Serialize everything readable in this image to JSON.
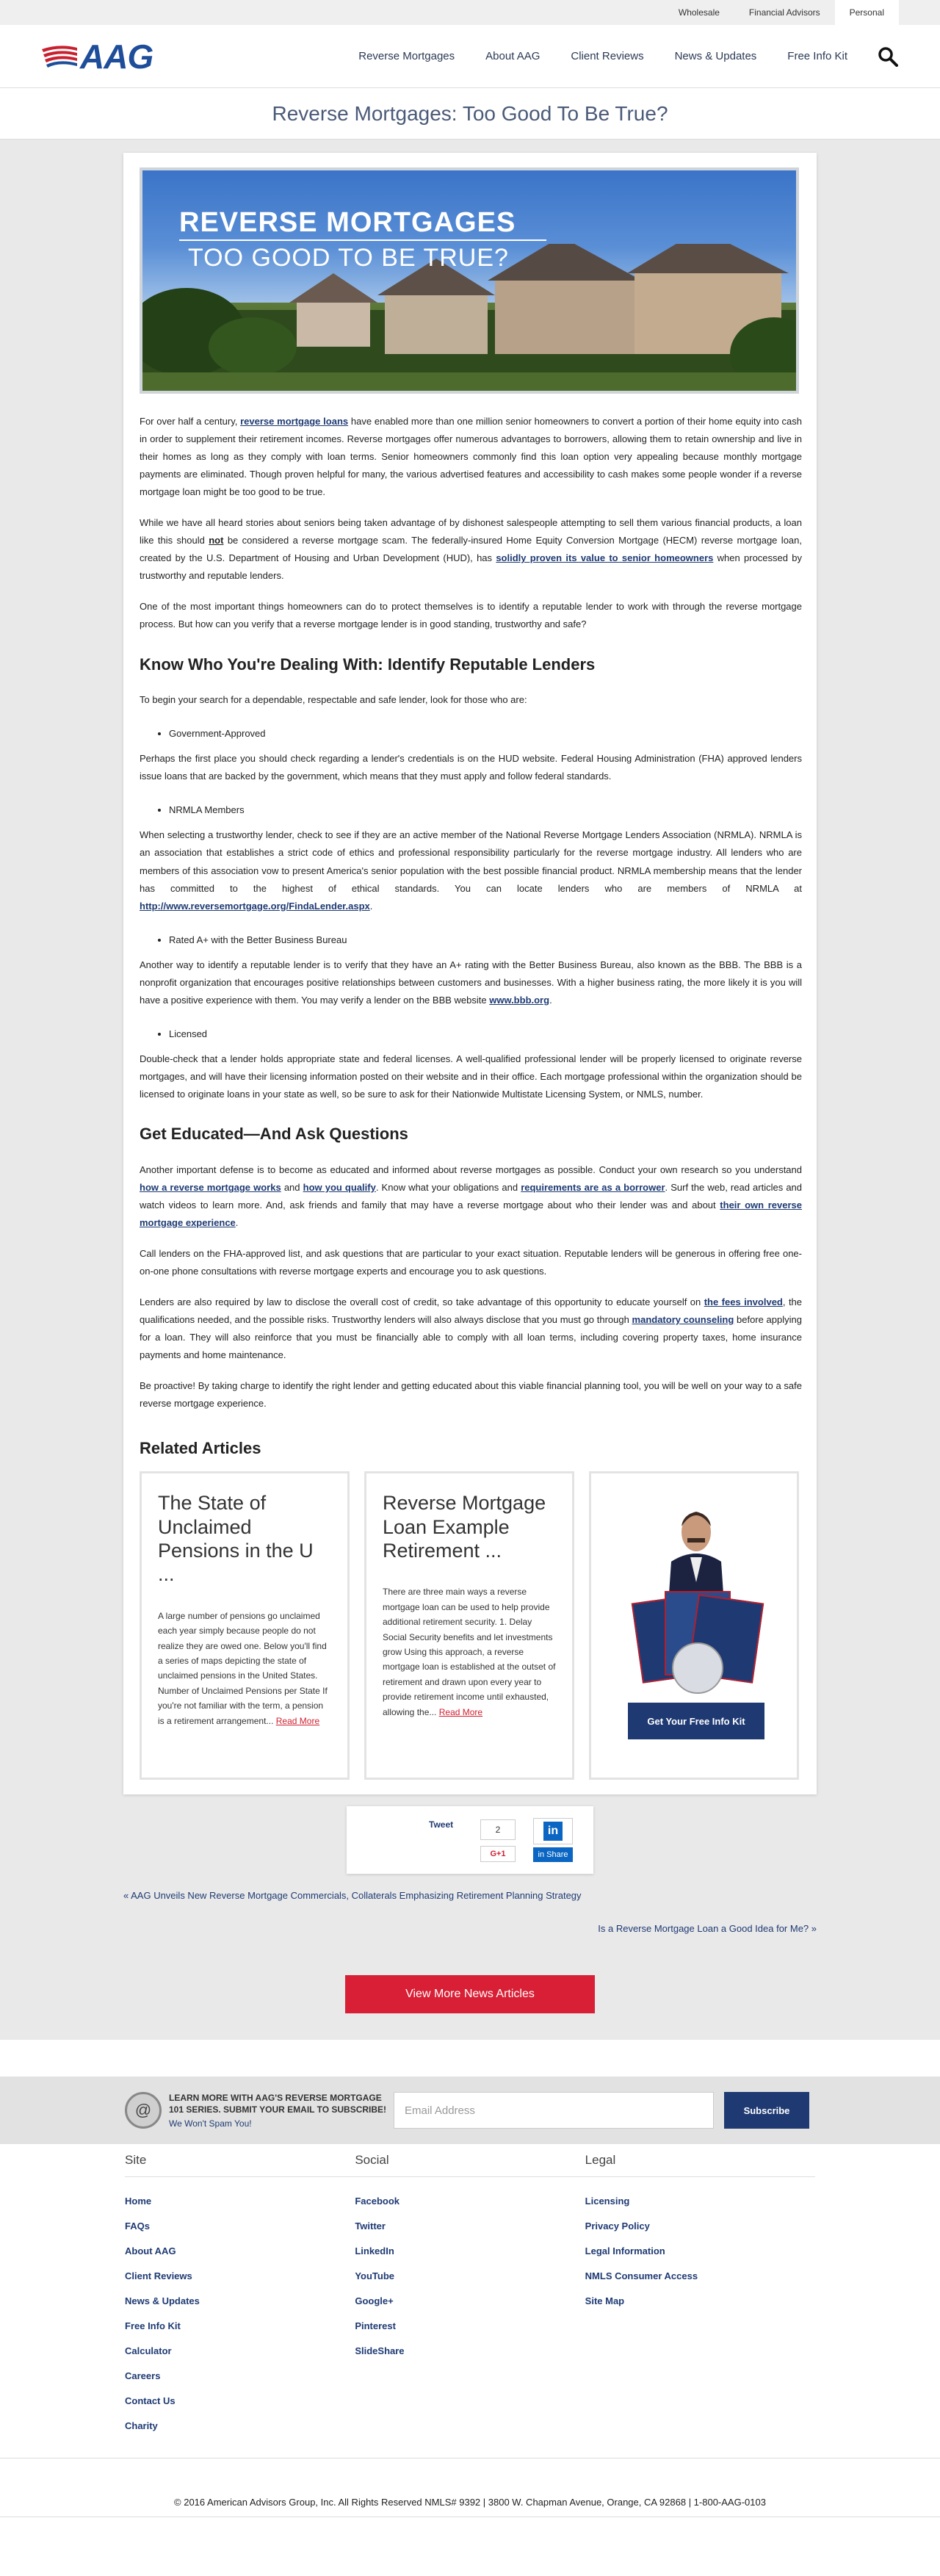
{
  "topbar": {
    "items": [
      "Wholesale",
      "Financial Advisors",
      "Personal"
    ]
  },
  "header": {
    "logo_text": "AAG",
    "nav": [
      "Reverse Mortgages",
      "About AAG",
      "Client Reviews",
      "News & Updates",
      "Free Info Kit"
    ]
  },
  "page_title": "Reverse Mortgages: Too Good To Be True?",
  "hero": {
    "line1": "REVERSE MORTGAGES",
    "line2": "TOO GOOD TO BE TRUE?"
  },
  "article": {
    "p1_a": "For over half a century, ",
    "p1_link": "reverse mortgage loans",
    "p1_b": " have enabled more than one million senior homeowners to convert a portion of their home equity into cash in order to supplement their retirement incomes.  Reverse mortgages offer numerous advantages to borrowers, allowing them to retain ownership and live in their homes as long as they comply with loan terms. Senior homeowners commonly find this loan option very appealing because monthly mortgage payments are eliminated. Though proven helpful for many, the various advertised features and accessibility to cash makes some people wonder if a reverse mortgage loan might be too good to be true.",
    "p2_a": "While we have all heard stories about seniors being taken advantage of by dishonest salespeople attempting to sell them various financial products, a loan like this should ",
    "p2_not": "not",
    "p2_b": " be considered a reverse mortgage scam.  The federally-insured Home Equity Conversion Mortgage (HECM) reverse mortgage loan, created by the U.S. Department of Housing and Urban Development (HUD), has ",
    "p2_link": "solidly proven its value to senior homeowners",
    "p2_c": " when processed by trustworthy and reputable lenders.",
    "p3": "One of the most important things homeowners can do to protect themselves is to identify a reputable lender to work with through the reverse mortgage process.  But how can you verify that a reverse mortgage lender is in good standing, trustworthy and safe?",
    "h1": "Know Who You're Dealing With: Identify Reputable Lenders",
    "p4": "To begin your search for a dependable, respectable and safe lender, look for those who are:",
    "b1": "Government-Approved",
    "p5": "Perhaps the first place you should check regarding a lender's credentials is on the HUD website.   Federal Housing Administration (FHA) approved lenders issue loans that are backed by the government, which means that they must apply and follow federal standards.",
    "b2": "NRMLA Members",
    "p6_a": "When selecting a trustworthy lender, check to see if they are an active member of the National Reverse Mortgage Lenders Association (NRMLA). NRMLA is an association that establishes a strict code of ethics and professional responsibility particularly for the reverse mortgage industry.  All lenders who are members of this association vow to present America's senior population with the best possible financial product.   NRMLA membership means that the lender has committed to the highest of ethical standards.  You can locate lenders who are members of NRMLA at ",
    "p6_link": "http://www.reversemortgage.org/FindaLender.aspx",
    "p6_b": ".",
    "b3": "Rated A+ with the Better Business Bureau",
    "p7_a": "Another way to identify a reputable lender is to verify that they have an A+ rating with the Better Business Bureau, also known as the BBB. The BBB is a nonprofit organization that encourages positive relationships between customers and businesses. With a higher business rating, the more likely it is you will have a positive experience with them. You may verify a lender on the BBB website ",
    "p7_link": "www.bbb.org",
    "p7_b": ".",
    "b4": "Licensed",
    "p8": "Double-check that a lender holds appropriate state and federal licenses.  A well-qualified professional lender will be properly licensed to originate reverse mortgages, and will have their licensing information posted on their website and in their office. Each mortgage professional within the organization should be licensed to originate loans in your state as well, so be sure to ask for their Nationwide Multistate Licensing System, or NMLS, number.",
    "h2": "Get Educated—And Ask Questions",
    "p9_a": "Another important defense is to become as educated and informed about reverse mortgages as possible. Conduct your own research so you understand ",
    "p9_l1": "how a reverse mortgage works",
    "p9_b": " and ",
    "p9_l2": "how you qualify",
    "p9_c": ". Know what your obligations and ",
    "p9_l3": "requirements are as a borrower",
    "p9_d": ". Surf the web, read articles and watch videos to learn more. And, ask friends and family that may have a reverse mortgage about who their lender was and about ",
    "p9_l4": "their own reverse mortgage experience",
    "p9_e": ".",
    "p10": "Call lenders on the FHA-approved list, and ask questions that are particular to your exact situation.  Reputable lenders will be generous in offering free one-on-one phone consultations with reverse mortgage experts and encourage you to ask questions.",
    "p11_a": "Lenders are also required by law to disclose the overall cost of credit, so take advantage of this opportunity to educate yourself on ",
    "p11_l1": "the fees involved",
    "p11_b": ", the qualifications needed, and the possible risks.  Trustworthy lenders will also always disclose that you must go through ",
    "p11_l2": "mandatory counseling",
    "p11_c": " before applying for a loan. They will also reinforce that you must be financially able to comply with all loan terms, including covering property taxes, home insurance payments and home maintenance.",
    "p12": "Be proactive! By taking charge to identify the right lender and getting educated about this viable financial planning tool, you will be well on your way to a safe reverse mortgage experience."
  },
  "related": {
    "title": "Related Articles",
    "cards": [
      {
        "title": "The State of Unclaimed Pensions in the U ...",
        "body": "A large number of pensions go unclaimed each year simply because people do not realize they are owed one. Below you'll find a series of maps depicting the state of unclaimed pensions in the United States. Number of Unclaimed Pensions per State If you're not familiar with the term, a pension is a retirement arrangement...",
        "more": "Read More"
      },
      {
        "title": "Reverse Mortgage Loan Example Retirement ...",
        "body": "There are three main ways a reverse mortgage loan can be used to help provide additional retirement security.   1. Delay Social Security benefits and let investments grow Using this approach, a reverse mortgage loan is established at the outset of retirement and drawn upon every year to provide retirement income until exhausted, allowing the...",
        "more": "Read More"
      }
    ],
    "promo_button": "Get Your Free Info Kit"
  },
  "share": {
    "tweet": "Tweet",
    "count": "2",
    "gplus": "G+1",
    "linkedin_share": "in Share"
  },
  "postnav": {
    "prev": "« AAG Unveils New Reverse Mortgage Commercials, Collaterals Emphasizing Retirement Planning Strategy",
    "next": "Is a Reverse Mortgage Loan a Good Idea for Me? »"
  },
  "more_button": "View More News Articles",
  "subscribe": {
    "text": "LEARN MORE WITH AAG'S REVERSE MORTGAGE 101 SERIES. SUBMIT YOUR EMAIL TO SUBSCRIBE!",
    "spam": "We Won't Spam You!",
    "placeholder": "Email Address",
    "button": "Subscribe"
  },
  "footer": {
    "site": {
      "title": "Site",
      "items": [
        "Home",
        "FAQs",
        "About AAG",
        "Client Reviews",
        "News & Updates",
        "Free Info Kit",
        "Calculator",
        "Careers",
        "Contact Us",
        "Charity"
      ]
    },
    "social": {
      "title": "Social",
      "items": [
        "Facebook",
        "Twitter",
        "LinkedIn",
        "YouTube",
        "Google+",
        "Pinterest",
        "SlideShare"
      ]
    },
    "legal": {
      "title": "Legal",
      "items": [
        "Licensing",
        "Privacy Policy",
        "Legal Information",
        "NMLS Consumer Access",
        "Site Map"
      ]
    },
    "copyright": "© 2016 American Advisors Group, Inc. All Rights Reserved NMLS# 9392 | 3800 W. Chapman Avenue, Orange, CA 92868 | 1-800-AAG-0103"
  },
  "colors": {
    "brand_blue": "#1f3a73",
    "brand_red": "#d81f35",
    "link": "#1e3a73"
  }
}
